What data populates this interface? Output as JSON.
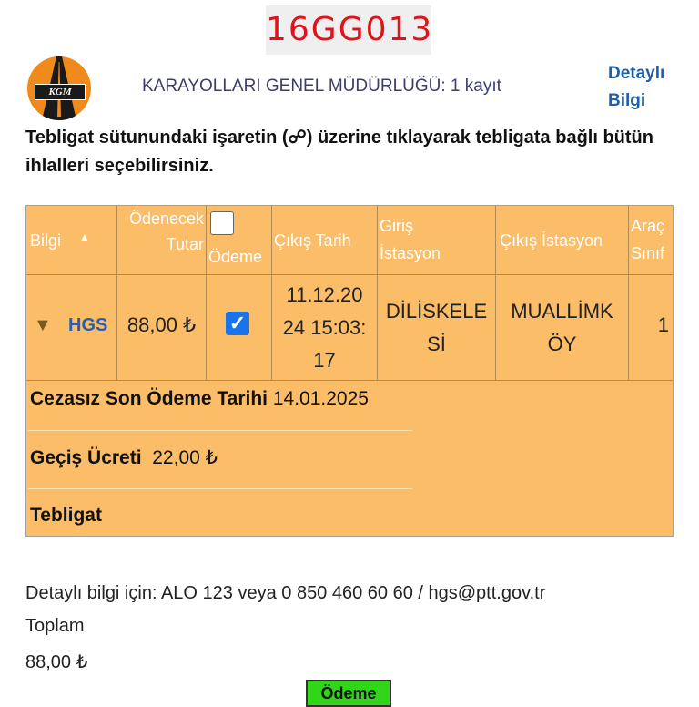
{
  "header": {
    "plate": "16GG013",
    "logo_text": "KGM",
    "agency_line": "KARAYOLLARI GENEL MÜDÜRLÜĞÜ: 1 kayıt",
    "detail_link_line1": "Detaylı",
    "detail_link_line2": "Bilgi"
  },
  "instruction": "Tebligat sütunundaki işaretin (☍) üzerine tıklayarak tebligata bağlı bütün ihlalleri seçebilirsiniz.",
  "table": {
    "headers": {
      "bilgi": "Bilgi",
      "sort_indicator": "▲",
      "tutar_line1": "Ödenecek",
      "tutar_line2": "Tutar",
      "odeme": "Ödeme",
      "cikis_tarih": "Çıkış Tarih",
      "giris_line1": "Giriş",
      "giris_line2": "İstasyon",
      "cikis_istasyon": "Çıkış İstasyon",
      "arac_line1": "Araç",
      "arac_line2": "Sınıf"
    },
    "row": {
      "expand_icon": "▼",
      "type": "HGS",
      "amount": "88,00 ₺",
      "date_line1": "11.12.20",
      "date_line2": "24 15:03:",
      "date_line3": "17",
      "entry_line1": "DİLİSKELE",
      "entry_line2": "Sİ",
      "exit_line1": "MUALLİMK",
      "exit_line2": "ÖY",
      "vehicle_class": "1"
    },
    "details": {
      "deadline_label": "Cezasız Son Ödeme Tarihi",
      "deadline_value": "14.01.2025",
      "toll_label": "Geçiş Ücreti",
      "toll_value": "22,00 ₺",
      "notice_label": "Tebligat"
    }
  },
  "footer": {
    "contact": "Detaylı bilgi için: ALO 123 veya 0 850 460 60 60 / hgs@ptt.gov.tr",
    "total_label": "Toplam",
    "total_value": "88,00 ₺",
    "pay_button": "Ödeme"
  },
  "colors": {
    "plate_text": "#e0121b",
    "table_bg": "#fbbd67",
    "link": "#1f5fa8",
    "checkbox": "#1a73e8",
    "pay_button": "#31d619"
  }
}
